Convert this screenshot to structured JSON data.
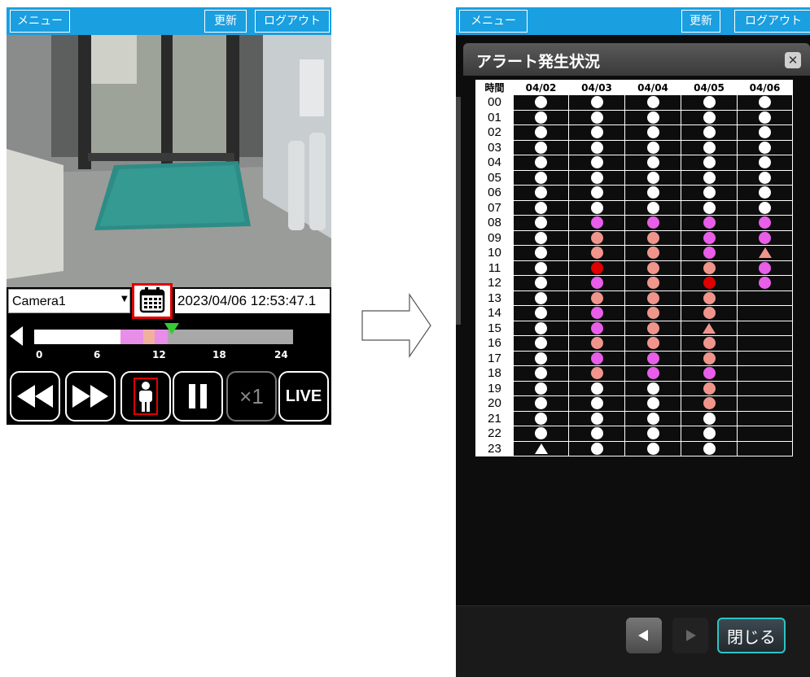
{
  "left_screen": {
    "menu_label": "メニュー",
    "refresh_label": "更新",
    "logout_label": "ログアウト",
    "camera_select": "Camera1",
    "datetime": "2023/04/06 12:53:47.1",
    "timeline_ticks": [
      "0",
      "6",
      "12",
      "18",
      "24"
    ],
    "speed_label": "×1",
    "live_label": "LIVE",
    "icons": [
      "rewind-icon",
      "fast-forward-icon",
      "person-detect-icon",
      "pause-icon",
      "calendar-icon"
    ]
  },
  "right_screen": {
    "menu_label": "メニュー",
    "refresh_label": "更新",
    "logout_label": "ログアウト",
    "dialog_title": "アラート発生状況",
    "table_header": {
      "time": "時間",
      "dates": [
        "04/02",
        "04/03",
        "04/04",
        "04/05",
        "04/06"
      ]
    },
    "hours": [
      "00",
      "01",
      "02",
      "03",
      "04",
      "05",
      "06",
      "07",
      "08",
      "09",
      "10",
      "11",
      "12",
      "13",
      "14",
      "15",
      "16",
      "17",
      "18",
      "19",
      "20",
      "21",
      "22",
      "23"
    ],
    "cells": [
      [
        "W",
        "W",
        "W",
        "W",
        "W"
      ],
      [
        "W",
        "W",
        "W",
        "W",
        "W"
      ],
      [
        "W",
        "W",
        "W",
        "W",
        "W"
      ],
      [
        "W",
        "W",
        "W",
        "W",
        "W"
      ],
      [
        "W",
        "W",
        "W",
        "W",
        "W"
      ],
      [
        "W",
        "W",
        "W",
        "W",
        "W"
      ],
      [
        "W",
        "W",
        "W",
        "W",
        "W"
      ],
      [
        "W",
        "W",
        "W",
        "W",
        "W"
      ],
      [
        "W",
        "M",
        "M",
        "M",
        "M"
      ],
      [
        "W",
        "S",
        "S",
        "M",
        "M"
      ],
      [
        "W",
        "S",
        "S",
        "M",
        "tS"
      ],
      [
        "W",
        "R",
        "S",
        "S",
        "M"
      ],
      [
        "W",
        "M",
        "S",
        "R",
        "M"
      ],
      [
        "W",
        "S",
        "S",
        "S",
        ""
      ],
      [
        "W",
        "M",
        "S",
        "S",
        ""
      ],
      [
        "W",
        "M",
        "S",
        "tS",
        ""
      ],
      [
        "W",
        "S",
        "S",
        "S",
        ""
      ],
      [
        "W",
        "M",
        "M",
        "S",
        ""
      ],
      [
        "W",
        "S",
        "M",
        "M",
        ""
      ],
      [
        "W",
        "W",
        "W",
        "S",
        ""
      ],
      [
        "W",
        "W",
        "W",
        "S",
        ""
      ],
      [
        "W",
        "W",
        "W",
        "W",
        ""
      ],
      [
        "W",
        "W",
        "W",
        "W",
        ""
      ],
      [
        "tW",
        "W",
        "W",
        "W",
        ""
      ]
    ],
    "close_label": "閉じる",
    "colors": {
      "white": "#ffffff",
      "magenta": "#e85ee8",
      "salmon": "#f0958c",
      "red": "#e00000",
      "accent": "#1a9fe0"
    }
  }
}
